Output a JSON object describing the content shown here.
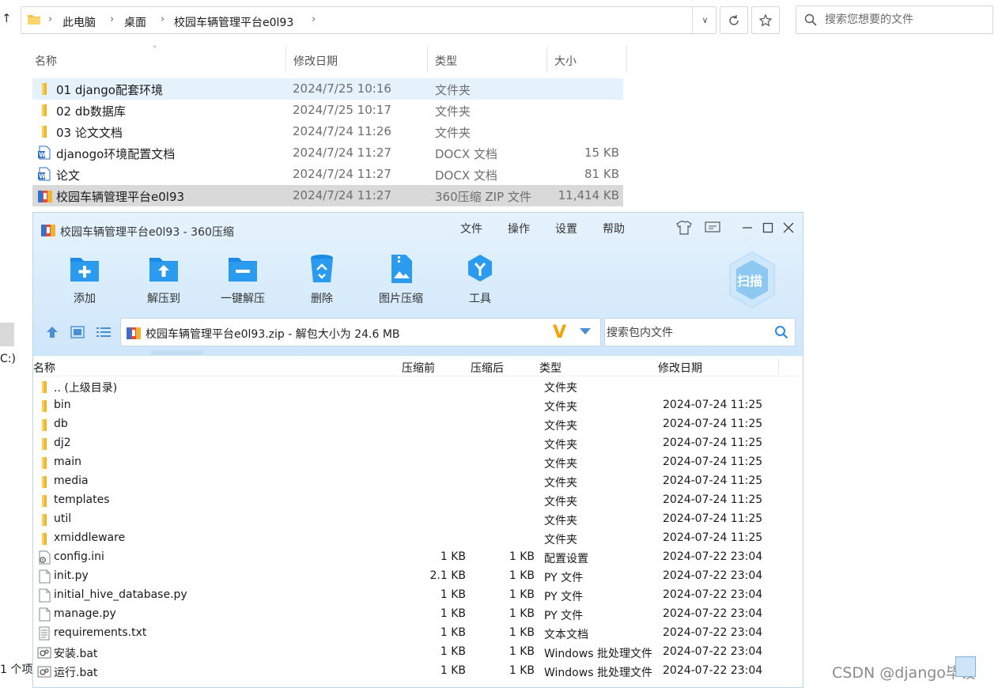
{
  "explorer": {
    "breadcrumb": [
      "此电脑",
      "桌面",
      "校园车辆管理平台e0l93"
    ],
    "search_placeholder": "搜索您想要的文件",
    "columns": {
      "name": "名称",
      "modified": "修改日期",
      "type": "类型",
      "size": "大小"
    },
    "rows": [
      {
        "name": "01 django配套环境",
        "date": "2024/7/25 10:16",
        "type": "文件夹",
        "size": "",
        "icon": "folder-icon"
      },
      {
        "name": "02 db数据库",
        "date": "2024/7/25 10:17",
        "type": "文件夹",
        "size": "",
        "icon": "folder-icon"
      },
      {
        "name": "03 论文文档",
        "date": "2024/7/24 11:26",
        "type": "文件夹",
        "size": "",
        "icon": "folder-icon"
      },
      {
        "name": "djanogo环境配置文档",
        "date": "2024/7/24 11:27",
        "type": "DOCX 文档",
        "size": "15 KB",
        "icon": "word-doc-icon"
      },
      {
        "name": "论文",
        "date": "2024/7/24 11:27",
        "type": "DOCX 文档",
        "size": "81 KB",
        "icon": "word-doc-icon"
      },
      {
        "name": "校园车辆管理平台e0l93",
        "date": "2024/7/24 11:27",
        "type": "360压缩 ZIP 文件",
        "size": "11,414 KB",
        "icon": "zip-archive-icon"
      }
    ],
    "left_fragment_drive": "C:)",
    "left_fragment_count": "1 个项"
  },
  "zip": {
    "title": "校园车辆管理平台e0l93 - 360压缩",
    "menu": [
      "文件",
      "操作",
      "设置",
      "帮助"
    ],
    "tools": [
      "添加",
      "解压到",
      "一键解压",
      "删除",
      "图片压缩",
      "工具"
    ],
    "scan_label": "扫描",
    "path_text": "校园车辆管理平台e0l93.zip - 解包大小为 24.6 MB",
    "path_v": "V",
    "search_placeholder": "搜索包内文件",
    "columns": {
      "name": "名称",
      "before": "压缩前",
      "after": "压缩后",
      "type": "类型",
      "modified": "修改日期"
    },
    "rows": [
      {
        "name": ".. (上级目录)",
        "before": "",
        "after": "",
        "type": "文件夹",
        "date": "",
        "icon": "folder-icon"
      },
      {
        "name": "bin",
        "before": "",
        "after": "",
        "type": "文件夹",
        "date": "2024-07-24 11:25",
        "icon": "folder-icon"
      },
      {
        "name": "db",
        "before": "",
        "after": "",
        "type": "文件夹",
        "date": "2024-07-24 11:25",
        "icon": "folder-icon"
      },
      {
        "name": "dj2",
        "before": "",
        "after": "",
        "type": "文件夹",
        "date": "2024-07-24 11:25",
        "icon": "folder-icon"
      },
      {
        "name": "main",
        "before": "",
        "after": "",
        "type": "文件夹",
        "date": "2024-07-24 11:25",
        "icon": "folder-icon"
      },
      {
        "name": "media",
        "before": "",
        "after": "",
        "type": "文件夹",
        "date": "2024-07-24 11:25",
        "icon": "folder-icon"
      },
      {
        "name": "templates",
        "before": "",
        "after": "",
        "type": "文件夹",
        "date": "2024-07-24 11:25",
        "icon": "folder-icon"
      },
      {
        "name": "util",
        "before": "",
        "after": "",
        "type": "文件夹",
        "date": "2024-07-24 11:25",
        "icon": "folder-icon"
      },
      {
        "name": "xmiddleware",
        "before": "",
        "after": "",
        "type": "文件夹",
        "date": "2024-07-24 11:25",
        "icon": "folder-icon"
      },
      {
        "name": "config.ini",
        "before": "1 KB",
        "after": "1 KB",
        "type": "配置设置",
        "date": "2024-07-22 23:04",
        "icon": "config-file-icon"
      },
      {
        "name": "init.py",
        "before": "2.1 KB",
        "after": "1 KB",
        "type": "PY 文件",
        "date": "2024-07-22 23:04",
        "icon": "blank-file-icon"
      },
      {
        "name": "initial_hive_database.py",
        "before": "1 KB",
        "after": "1 KB",
        "type": "PY 文件",
        "date": "2024-07-22 23:04",
        "icon": "blank-file-icon"
      },
      {
        "name": "manage.py",
        "before": "1 KB",
        "after": "1 KB",
        "type": "PY 文件",
        "date": "2024-07-22 23:04",
        "icon": "blank-file-icon"
      },
      {
        "name": "requirements.txt",
        "before": "1 KB",
        "after": "1 KB",
        "type": "文本文档",
        "date": "2024-07-22 23:04",
        "icon": "text-file-icon"
      },
      {
        "name": "安装.bat",
        "before": "1 KB",
        "after": "1 KB",
        "type": "Windows 批处理文件",
        "date": "2024-07-22 23:04",
        "icon": "batch-file-icon"
      },
      {
        "name": "运行.bat",
        "before": "1 KB",
        "after": "1 KB",
        "type": "Windows 批处理文件",
        "date": "2024-07-22 23:04",
        "icon": "batch-file-icon"
      }
    ]
  },
  "watermark": "CSDN @django毕设",
  "colors": {
    "folder": "#f6c343",
    "zip_header_bg": "#d7ebfb",
    "tool_blue": "#1a8ae6",
    "selection_light": "#e5f2fc",
    "selection_gray": "#d9d9d9"
  }
}
